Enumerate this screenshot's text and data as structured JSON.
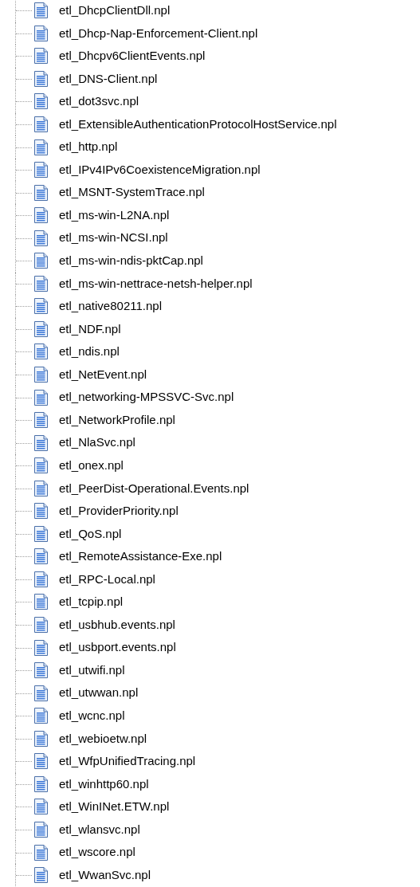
{
  "tree": {
    "items": [
      {
        "label": "etl_DhcpClientDll.npl"
      },
      {
        "label": "etl_Dhcp-Nap-Enforcement-Client.npl"
      },
      {
        "label": "etl_Dhcpv6ClientEvents.npl"
      },
      {
        "label": "etl_DNS-Client.npl"
      },
      {
        "label": "etl_dot3svc.npl"
      },
      {
        "label": "etl_ExtensibleAuthenticationProtocolHostService.npl"
      },
      {
        "label": "etl_http.npl"
      },
      {
        "label": "etl_IPv4IPv6CoexistenceMigration.npl"
      },
      {
        "label": "etl_MSNT-SystemTrace.npl"
      },
      {
        "label": "etl_ms-win-L2NA.npl"
      },
      {
        "label": "etl_ms-win-NCSI.npl"
      },
      {
        "label": "etl_ms-win-ndis-pktCap.npl"
      },
      {
        "label": "etl_ms-win-nettrace-netsh-helper.npl"
      },
      {
        "label": "etl_native80211.npl"
      },
      {
        "label": "etl_NDF.npl"
      },
      {
        "label": "etl_ndis.npl"
      },
      {
        "label": "etl_NetEvent.npl"
      },
      {
        "label": "etl_networking-MPSSVC-Svc.npl"
      },
      {
        "label": "etl_NetworkProfile.npl"
      },
      {
        "label": "etl_NlaSvc.npl"
      },
      {
        "label": "etl_onex.npl"
      },
      {
        "label": "etl_PeerDist-Operational.Events.npl"
      },
      {
        "label": "etl_ProviderPriority.npl"
      },
      {
        "label": "etl_QoS.npl"
      },
      {
        "label": "etl_RemoteAssistance-Exe.npl"
      },
      {
        "label": "etl_RPC-Local.npl"
      },
      {
        "label": "etl_tcpip.npl"
      },
      {
        "label": "etl_usbhub.events.npl"
      },
      {
        "label": "etl_usbport.events.npl"
      },
      {
        "label": "etl_utwifi.npl"
      },
      {
        "label": "etl_utwwan.npl"
      },
      {
        "label": "etl_wcnc.npl"
      },
      {
        "label": "etl_webioetw.npl"
      },
      {
        "label": "etl_WfpUnifiedTracing.npl"
      },
      {
        "label": "etl_winhttp60.npl"
      },
      {
        "label": "etl_WinINet.ETW.npl"
      },
      {
        "label": "etl_wlansvc.npl"
      },
      {
        "label": "etl_wscore.npl"
      },
      {
        "label": "etl_WwanSvc.npl"
      }
    ]
  }
}
